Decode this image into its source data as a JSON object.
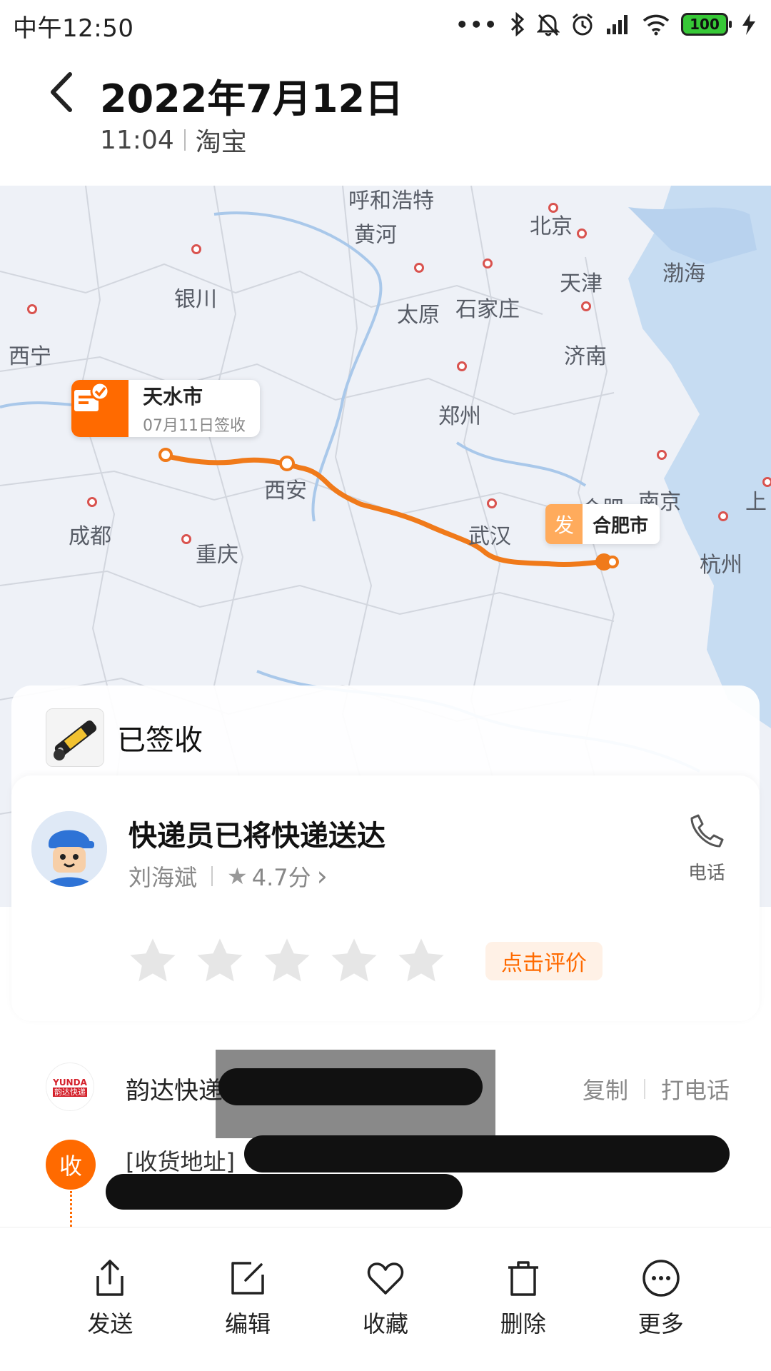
{
  "status_bar": {
    "time": "中午12:50",
    "battery": "100"
  },
  "header": {
    "date": "2022年7月12日",
    "time": "11:04",
    "source": "淘宝"
  },
  "map": {
    "cities": [
      "呼和浩特",
      "黄河",
      "北京",
      "天津",
      "渤海",
      "银川",
      "太原",
      "石家庄",
      "西宁",
      "济南",
      "郑州",
      "西安",
      "成都",
      "重庆",
      "武汉",
      "合肥",
      "南京",
      "杭州",
      "上"
    ],
    "destination": {
      "city": "天水市",
      "status": "07月11日签收"
    },
    "origin": {
      "badge": "发",
      "city": "合肥市"
    }
  },
  "package_status": {
    "label": "已签收"
  },
  "courier": {
    "title": "快递员已将快递送达",
    "name": "刘海斌",
    "rating": "4.7分",
    "rating_arrow": "›",
    "call_label": "电话",
    "rate_stars": 5,
    "rate_cta": "点击评价"
  },
  "carrier": {
    "logo_text": "YUNDA",
    "logo_sub": "韵达快递",
    "name": "韵达快递",
    "copy_label": "复制",
    "call_label": "打电话",
    "recv_badge": "收",
    "address_label": "[收货地址]"
  },
  "bottom_bar": [
    {
      "name": "send",
      "label": "发送",
      "icon": "share-icon"
    },
    {
      "name": "edit",
      "label": "编辑",
      "icon": "edit-icon"
    },
    {
      "name": "favorite",
      "label": "收藏",
      "icon": "heart-icon"
    },
    {
      "name": "delete",
      "label": "删除",
      "icon": "trash-icon"
    },
    {
      "name": "more",
      "label": "更多",
      "icon": "more-icon"
    }
  ],
  "colors": {
    "accent": "#ff6a00",
    "route": "#f07a1a",
    "water": "#c6dcf2"
  }
}
